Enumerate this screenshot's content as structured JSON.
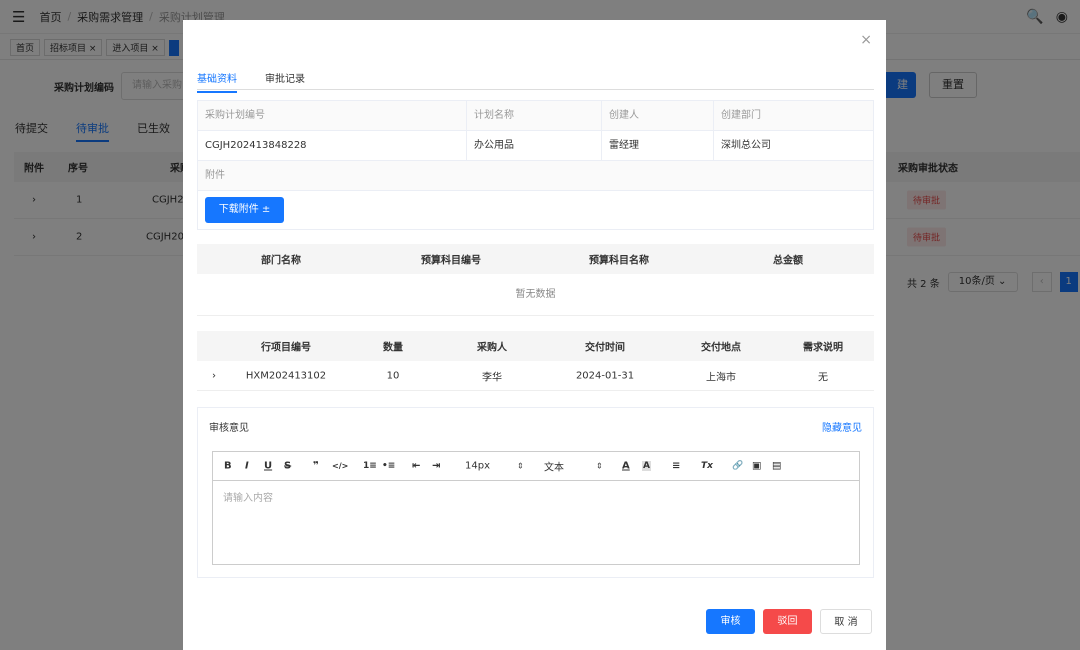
{
  "header": {
    "menu_icon": "menu-fold-icon",
    "breadcrumb": [
      "首页",
      "采购需求管理",
      "采购计划管理"
    ],
    "right_icons": [
      "search-icon",
      "github-icon"
    ]
  },
  "tags": [
    "首页",
    "招标项目 ×",
    "进入项目 ×"
  ],
  "search": {
    "label": "采购计划编码",
    "placeholder": "请输入采购",
    "search_btn": "建",
    "reset_btn": "重置"
  },
  "status_tabs": [
    "待提交",
    "待审批",
    "已生效"
  ],
  "bg_table": {
    "headers": [
      "附件",
      "序号",
      "采购",
      "采购审批状态"
    ],
    "rows": [
      {
        "expander": "›",
        "index": "1",
        "code": "CGJH2",
        "status": "待审批"
      },
      {
        "expander": "›",
        "index": "2",
        "code": "CGJH20",
        "status": "待审批"
      }
    ]
  },
  "pager": {
    "total": "共 2 条",
    "size": "10条/页 ⌄",
    "prev": "‹",
    "page": "1"
  },
  "modal": {
    "close": "×",
    "tabs": [
      "基础资料",
      "审批记录"
    ],
    "info_headers": [
      "采购计划编号",
      "计划名称",
      "创建人",
      "创建部门"
    ],
    "info_values": [
      "CGJH202413848228",
      "办公用品",
      "雷经理",
      "深圳总公司"
    ],
    "attach_label": "附件",
    "download_btn": "下载附件 ±",
    "budget_table": {
      "headers": [
        "部门名称",
        "预算科目编号",
        "预算科目名称",
        "总金额"
      ],
      "empty": "暂无数据"
    },
    "items_table": {
      "headers": [
        "行项目编号",
        "数量",
        "采购人",
        "交付时间",
        "交付地点",
        "需求说明"
      ],
      "rows": [
        {
          "expander": "›",
          "code": "HXM202413102",
          "qty": "10",
          "buyer": "李华",
          "date": "2024-01-31",
          "place": "上海市",
          "desc": "无"
        }
      ]
    },
    "review": {
      "title": "审核意见",
      "hide": "隐藏意见",
      "toolbar": {
        "bold": "B",
        "italic": "I",
        "underline": "U",
        "strike": "S",
        "quote": "❞",
        "code": "</>",
        "ol": "1≡",
        "ul": "•≡",
        "outdent": "⇤",
        "indent": "⇥",
        "font_size": "14px",
        "font_size_arrow": "⇕",
        "block": "文本",
        "block_arrow": "⇕",
        "color": "A",
        "bg_color": "A",
        "align": "≡",
        "clear": "Tx",
        "link": "🔗",
        "image": "▣",
        "video": "▤"
      },
      "placeholder": "请输入内容"
    },
    "buttons": {
      "approve": "审核",
      "reject": "驳回",
      "cancel": "取 消"
    }
  }
}
